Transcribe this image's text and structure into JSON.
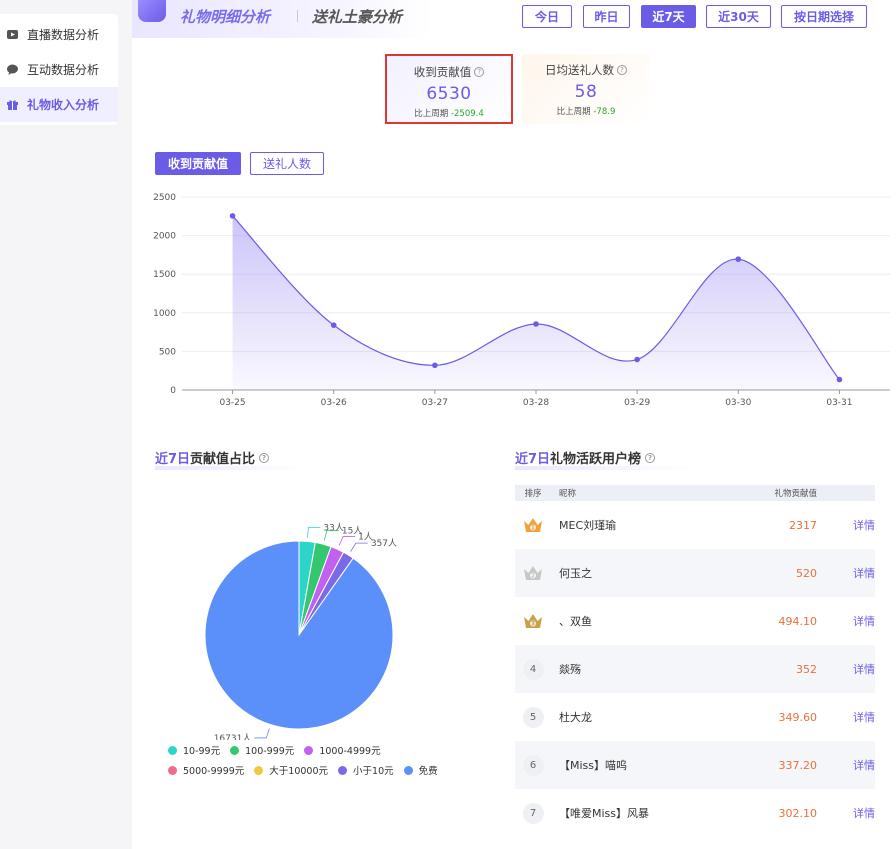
{
  "sidebar": {
    "items": [
      {
        "label": "直播数据分析",
        "icon": "video-icon"
      },
      {
        "label": "互动数据分析",
        "icon": "chat-icon"
      },
      {
        "label": "礼物收入分析",
        "icon": "gift-icon",
        "active": true
      }
    ]
  },
  "header": {
    "tab_gift_detail": "礼物明细分析",
    "tab_tycoon": "送礼土豪分析",
    "ranges": [
      "今日",
      "昨日",
      "近7天",
      "近30天",
      "按日期选择"
    ],
    "active_range": "近7天"
  },
  "summary_cards": [
    {
      "label": "收到贡献值",
      "value": "6530",
      "compare_label": "比上周期",
      "compare_value": "-2509.4"
    },
    {
      "label": "日均送礼人数",
      "value": "58",
      "compare_label": "比上周期",
      "compare_value": "-78.9"
    }
  ],
  "metric_toggle": {
    "active": "收到贡献值",
    "other": "送礼人数"
  },
  "chart_data": [
    {
      "type": "area",
      "categories": [
        "03-25",
        "03-26",
        "03-27",
        "03-28",
        "03-29",
        "03-30",
        "03-31"
      ],
      "series": [
        {
          "values": [
            2255,
            840,
            320,
            855,
            395,
            1695,
            135
          ]
        }
      ],
      "ylim": [
        0,
        2500
      ],
      "yticks": [
        0,
        500,
        1000,
        1500,
        2000,
        2500
      ],
      "grid": true,
      "color": "#6b5ce7"
    },
    {
      "type": "pie",
      "labels": [
        "10-99元",
        "100-999元",
        "1000-4999元",
        "5000-9999元",
        "大于10000元",
        "小于10元",
        "免费"
      ],
      "values": [
        33,
        15,
        1,
        0,
        0,
        357,
        16731
      ],
      "data_labels": [
        "33人",
        "15人",
        "1人",
        "",
        "",
        "357人",
        "16731人"
      ],
      "colors": [
        "#2dd4c8",
        "#34c76f",
        "#c261f0",
        "#f06b8a",
        "#f5c542",
        "#7c69e8",
        "#5b8ff9"
      ]
    }
  ],
  "pie_section": {
    "title_highlight": "近7日",
    "title_rest": "贡献值占比"
  },
  "rank_section": {
    "title_highlight": "近7日",
    "title_rest": "礼物活跃用户榜",
    "columns": [
      "排序",
      "昵称",
      "礼物贡献值"
    ],
    "rows": [
      {
        "rank": "1",
        "name": "MEC刘瑾瑜",
        "value": "2317",
        "action": "详情"
      },
      {
        "rank": "2",
        "name": "何玉之",
        "value": "520",
        "action": "详情"
      },
      {
        "rank": "3",
        "name": "、双鱼",
        "value": "494.10",
        "action": "详情"
      },
      {
        "rank": "4",
        "name": "燚殇",
        "value": "352",
        "action": "详情"
      },
      {
        "rank": "5",
        "name": "杜大龙",
        "value": "349.60",
        "action": "详情"
      },
      {
        "rank": "6",
        "name": "【Miss】喵呜",
        "value": "337.20",
        "action": "详情"
      },
      {
        "rank": "7",
        "name": "【唯爱Miss】风暴",
        "value": "302.10",
        "action": "详情"
      }
    ]
  },
  "colors": {
    "accent": "#6b5ce7",
    "value_orange": "#e8703c",
    "delta_green": "#2aa52a"
  }
}
